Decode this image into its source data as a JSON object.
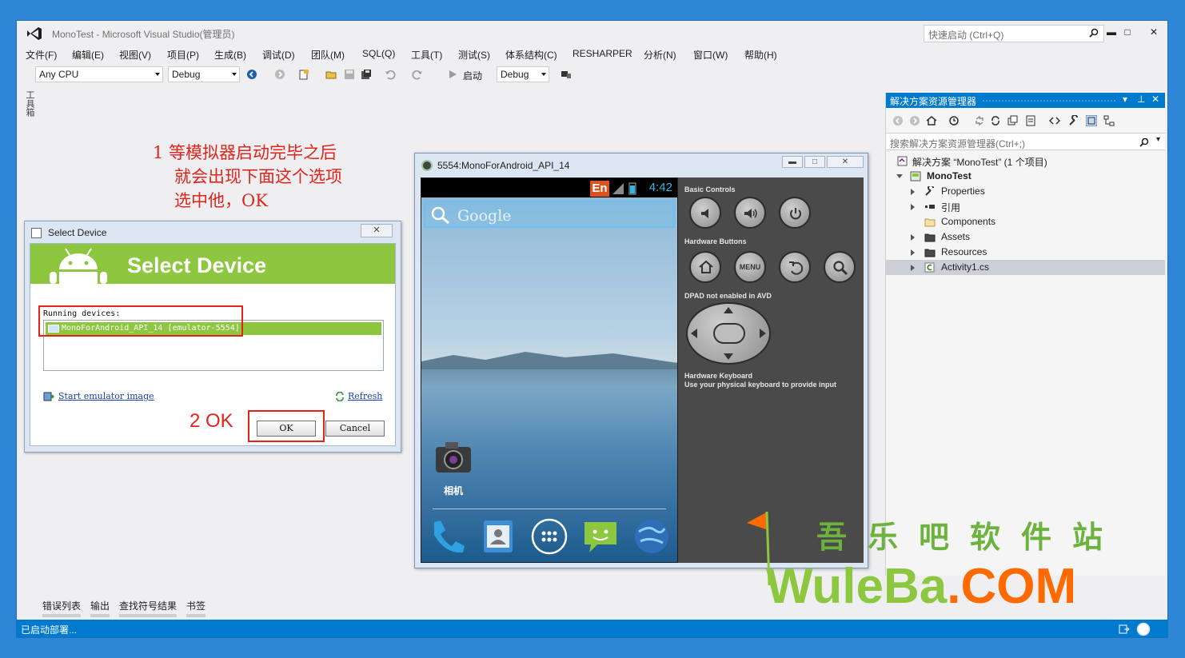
{
  "window": {
    "title": "MonoTest - Microsoft Visual Studio(管理员)",
    "quick_launch_placeholder": "快速启动 (Ctrl+Q)",
    "minimize": "▬",
    "maximize": "□",
    "close": "✕"
  },
  "menu": [
    "文件(F)",
    "编辑(E)",
    "视图(V)",
    "项目(P)",
    "生成(B)",
    "调试(D)",
    "团队(M)",
    "SQL(Q)",
    "工具(T)",
    "测试(S)",
    "体系结构(C)",
    "RESHARPER",
    "分析(N)",
    "窗口(W)",
    "帮助(H)"
  ],
  "toolbar": {
    "platform": "Any CPU",
    "config": "Debug",
    "start_label": "启动",
    "start_config": "Debug"
  },
  "left_strip": "工具箱",
  "annotation1": {
    "line1": "1  等模拟器启动完毕之后",
    "line2": "就会出现下面这个选项",
    "line3": "选中他，OK"
  },
  "dialog": {
    "title": "Select Device",
    "close": "✕",
    "banner_title": "Select Device",
    "running_label": "Running devices:",
    "device": "MonoForAndroid_API_14 [emulator-5554]",
    "start_link": "Start emulator image",
    "refresh_link": "Refresh",
    "ok_annotation": "2 OK",
    "ok": "OK",
    "cancel": "Cancel"
  },
  "emulator": {
    "title": "5554:MonoForAndroid_API_14",
    "status_time": "4:42",
    "en_badge": "En",
    "search_text": "Google",
    "camera_label": "相机",
    "basic_controls": "Basic Controls",
    "hardware_buttons": "Hardware Buttons",
    "menu_button": "MENU",
    "dpad_label": "DPAD not enabled in AVD",
    "keyboard_title": "Hardware Keyboard",
    "keyboard_desc": "Use your physical keyboard to provide input"
  },
  "solution_explorer": {
    "title": "解决方案资源管理器",
    "search_placeholder": "搜索解决方案资源管理器(Ctrl+;)",
    "items": [
      {
        "label": "解决方案 “MonoTest” (1 个项目)",
        "level": 0,
        "state": "none"
      },
      {
        "label": "MonoTest",
        "level": 0,
        "state": "open"
      },
      {
        "label": "Properties",
        "level": 1,
        "state": "closed"
      },
      {
        "label": "引用",
        "level": 1,
        "state": "closed"
      },
      {
        "label": "Components",
        "level": 1,
        "state": "none"
      },
      {
        "label": "Assets",
        "level": 1,
        "state": "closed"
      },
      {
        "label": "Resources",
        "level": 1,
        "state": "closed"
      },
      {
        "label": "Activity1.cs",
        "level": 1,
        "state": "closed"
      }
    ]
  },
  "bottom_tabs": [
    "错误列表",
    "输出",
    "查找符号结果",
    "书签"
  ],
  "status": "已启动部署...",
  "watermark": {
    "cn": "吾乐吧软件站",
    "en_a": "WuleBa",
    "en_dot": ".",
    "en_b": "COM"
  },
  "colors": {
    "accent": "#007acc",
    "android_green": "#8dc63f",
    "annotation_red": "#e0241b"
  }
}
